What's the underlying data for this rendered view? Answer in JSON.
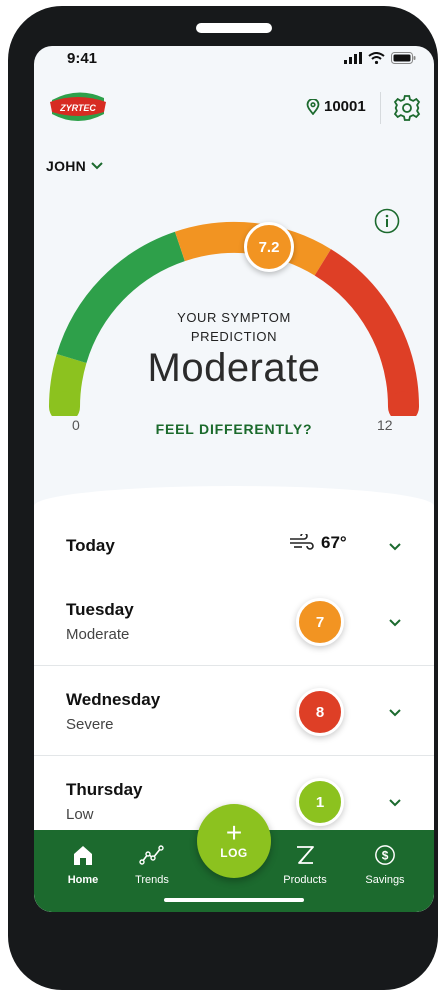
{
  "status_bar": {
    "time": "9:41"
  },
  "header": {
    "brand": "ZYRTEC",
    "zip": "10001"
  },
  "profile": {
    "name": "JOHN"
  },
  "prediction": {
    "score": "7.2",
    "score_value": 7.2,
    "scale_min": "0",
    "scale_max": "12",
    "label_line1": "YOUR SYMPTOM",
    "label_line2": "PREDICTION",
    "level": "Moderate",
    "feel_differently": "FEEL DIFFERENTLY?"
  },
  "forecast": [
    {
      "day": "Today",
      "weather_temp": "67°",
      "icon": "wind-icon"
    },
    {
      "day": "Tuesday",
      "level": "Moderate",
      "score": "7",
      "color": "#f29422"
    },
    {
      "day": "Wednesday",
      "level": "Severe",
      "score": "8",
      "color": "#de3f26"
    },
    {
      "day": "Thursday",
      "level": "Low",
      "score": "1",
      "color": "#8cc21f"
    }
  ],
  "nav": {
    "items": [
      {
        "label": "Home",
        "icon": "home-icon"
      },
      {
        "label": "Trends",
        "icon": "trends-icon"
      },
      {
        "label": "Products",
        "icon": "z-products-icon"
      },
      {
        "label": "Savings",
        "icon": "dollar-icon"
      }
    ],
    "log_label": "LOG"
  },
  "colors": {
    "brand_green": "#1c6a2e",
    "low_green": "#8cc21f",
    "mid_green": "#2ea04a",
    "moderate_orange": "#f29422",
    "severe_red": "#de3f26"
  }
}
